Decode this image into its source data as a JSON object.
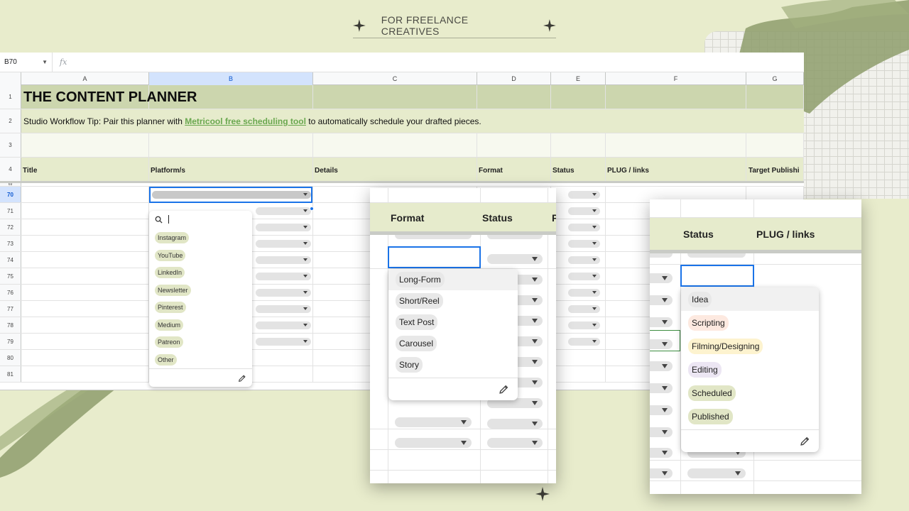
{
  "banner": {
    "text": "FOR FREELANCE CREATIVES"
  },
  "colors": {
    "background": "#e8eccc",
    "title_band": "#ccd6ae",
    "header_band": "#e6ebcc",
    "link": "#6aa84f",
    "selection": "#1a73e8",
    "brush": "#8e9d6c"
  },
  "sheet": {
    "name_box": "B70",
    "fx_label": "fx",
    "columns": [
      "A",
      "B",
      "C",
      "D",
      "E",
      "F",
      "G"
    ],
    "selected_column": "B",
    "top_rows": [
      "1",
      "2",
      "3",
      "4"
    ],
    "title": "THE CONTENT PLANNER",
    "tip_prefix": "Studio Workflow Tip: Pair this planner with ",
    "tip_link": "Metricool free scheduling tool",
    "tip_suffix": " to automatically schedule your drafted pieces.",
    "headers": {
      "title": "Title",
      "platform": "Platform/s",
      "details": "Details",
      "format": "Format",
      "status": "Status",
      "plug": "PLUG / links",
      "target": "Target Publishi"
    },
    "partial_row": "69",
    "data_rows": [
      "70",
      "71",
      "72",
      "73",
      "74",
      "75",
      "76",
      "77",
      "78",
      "79",
      "80",
      "81"
    ],
    "selected_row": "70"
  },
  "platform_dropdown": {
    "search_icon": "search-icon",
    "options": [
      "Instagram",
      "YouTube",
      "LinkedIn",
      "Newsletter",
      "Pinterest",
      "Medium",
      "Patreon",
      "Other"
    ],
    "edit_icon": "pencil-icon"
  },
  "format_panel": {
    "headers": {
      "format": "Format",
      "status": "Status",
      "partial": "P"
    },
    "options": [
      "Long-Form",
      "Short/Reel",
      "Text Post",
      "Carousel",
      "Story"
    ],
    "edit_icon": "pencil-icon"
  },
  "status_panel": {
    "headers": {
      "status": "Status",
      "plug": "PLUG / links"
    },
    "options": [
      {
        "label": "Idea",
        "color": "#ececec"
      },
      {
        "label": "Scripting",
        "color": "#fde9e0"
      },
      {
        "label": "Filming/Designing",
        "color": "#fdf3cf"
      },
      {
        "label": "Editing",
        "color": "#ece6f3"
      },
      {
        "label": "Scheduled",
        "color": "#e1e6c6"
      },
      {
        "label": "Published",
        "color": "#e1e6c6"
      }
    ],
    "edit_icon": "pencil-icon"
  }
}
